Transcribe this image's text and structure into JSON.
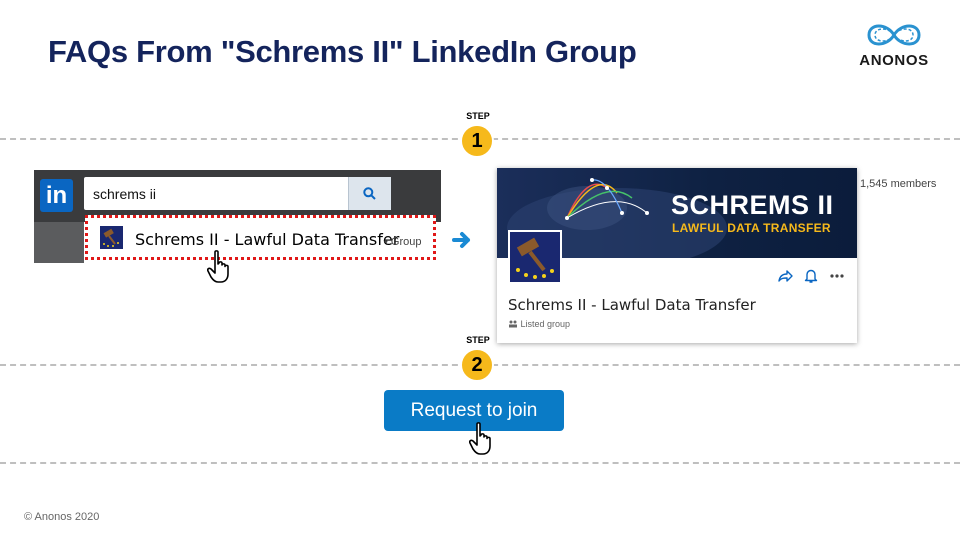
{
  "slide": {
    "title": "FAQs From \"Schrems II\" LinkedIn Group",
    "copyright": "© Anonos 2020"
  },
  "logo": {
    "text": "ANONOS",
    "icon": "anonos-infinity-icon",
    "color": "#2a92d0"
  },
  "steps": [
    {
      "label": "STEP",
      "number": "1"
    },
    {
      "label": "STEP",
      "number": "2"
    }
  ],
  "linkedin_search": {
    "logo_text": "in",
    "query": "schrems ii",
    "search_icon": "search-icon",
    "result": {
      "name": "Schrems II - Lawful Data Transfer",
      "type": "• Group"
    }
  },
  "group_card": {
    "banner_title": "SCHREMS II",
    "banner_subtitle": "LAWFUL DATA TRANSFER",
    "members": "1,545 members",
    "name": "Schrems II - Lawful Data Transfer",
    "listed": "Listed group",
    "action_icons": [
      "share-icon",
      "bell-icon",
      "more-icon"
    ]
  },
  "join": {
    "label": "Request to join"
  },
  "colors": {
    "title": "#14245c",
    "step_badge": "#f6b91b",
    "linkedin_blue": "#0a66c2",
    "join_button": "#0a7bc6",
    "highlight_border": "#e01818",
    "banner_accent": "#f6b91b"
  }
}
